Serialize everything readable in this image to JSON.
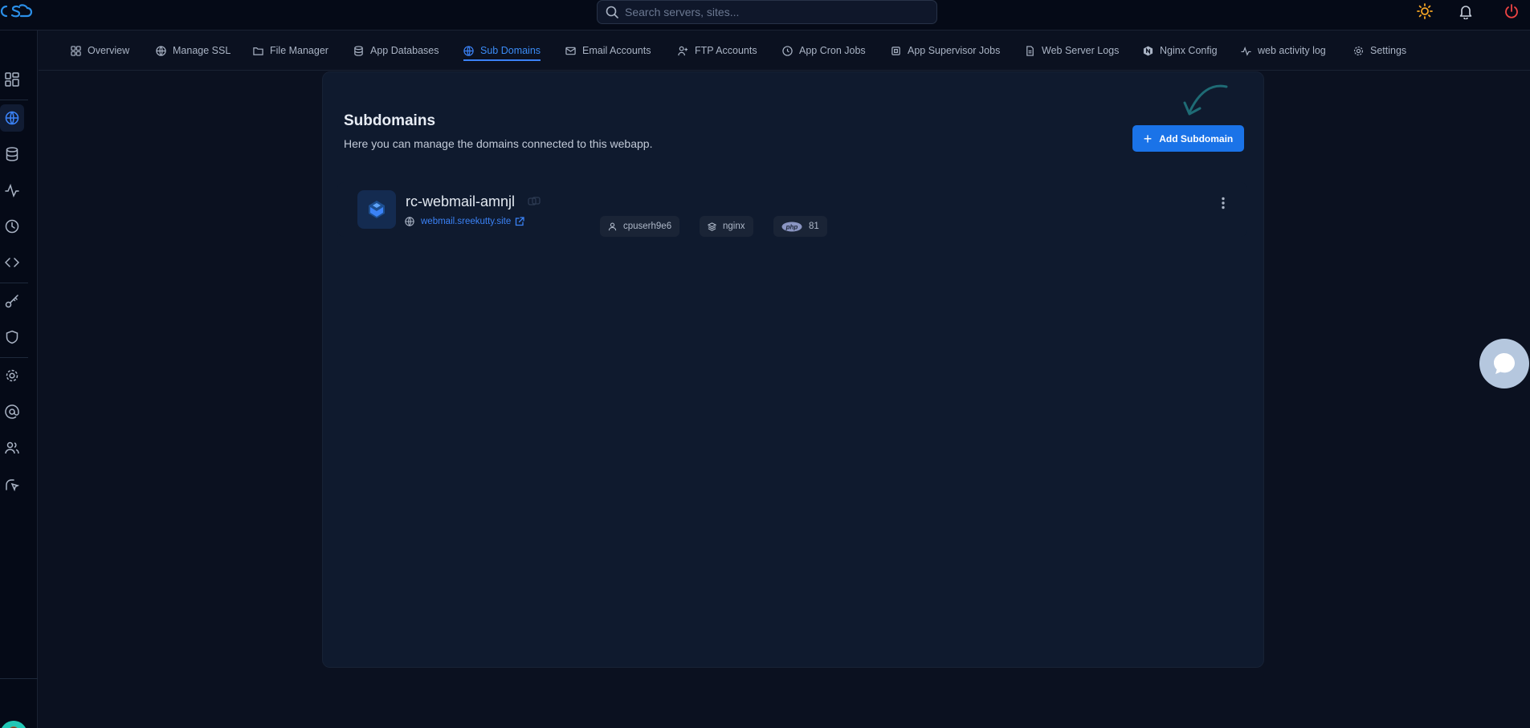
{
  "search": {
    "placeholder": "Search servers, sites..."
  },
  "tabs": [
    {
      "id": "overview",
      "label": "Overview",
      "icon": "grid-icon"
    },
    {
      "id": "ssl",
      "label": "Manage SSL",
      "icon": "globe-lock-icon"
    },
    {
      "id": "files",
      "label": "File Manager",
      "icon": "folder-icon"
    },
    {
      "id": "db",
      "label": "App Databases",
      "icon": "database-icon"
    },
    {
      "id": "subdomains",
      "label": "Sub Domains",
      "icon": "globe-icon",
      "active": true
    },
    {
      "id": "email",
      "label": "Email Accounts",
      "icon": "mail-icon"
    },
    {
      "id": "ftp",
      "label": "FTP Accounts",
      "icon": "user-plus-icon"
    },
    {
      "id": "cron",
      "label": "App Cron Jobs",
      "icon": "clock-globe-icon"
    },
    {
      "id": "supervisor",
      "label": "App Supervisor Jobs",
      "icon": "chip-icon"
    },
    {
      "id": "logs",
      "label": "Web Server Logs",
      "icon": "file-text-icon"
    },
    {
      "id": "nginx",
      "label": "Nginx Config",
      "icon": "nginx-icon"
    },
    {
      "id": "activity",
      "label": "web activity log",
      "icon": "activity-icon"
    },
    {
      "id": "settings",
      "label": "Settings",
      "icon": "gear-icon"
    }
  ],
  "page": {
    "title": "Subdomains",
    "subtitle": "Here you can manage the domains connected to this webapp.",
    "add_button": "Add Subdomain"
  },
  "subdomain": {
    "name": "rc-webmail-amnjl",
    "url": "webmail.sreekutty.site",
    "user": "cpuserh9e6",
    "server": "nginx",
    "php_badge": "php",
    "php_version": "81"
  },
  "colors": {
    "accent": "#1a73e8",
    "link": "#3b82f6",
    "danger": "#ef4444",
    "sun": "#f5a524"
  }
}
